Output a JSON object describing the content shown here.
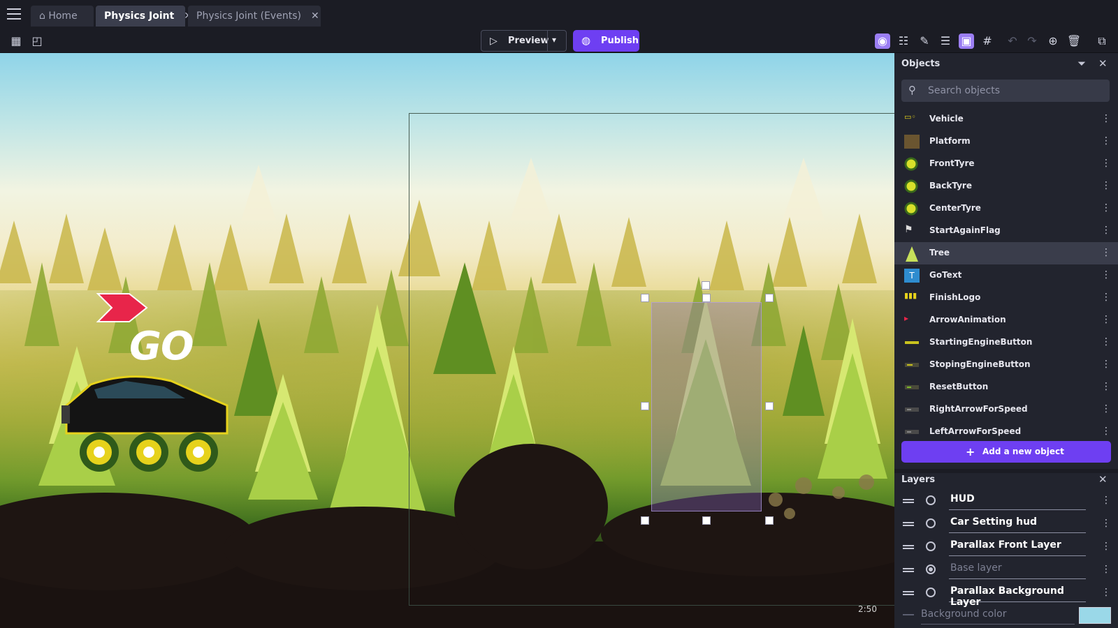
{
  "tabs": [
    {
      "label": "Home",
      "icon": "home-icon",
      "closable": false
    },
    {
      "label": "Physics Joint",
      "closable": true,
      "active": true
    },
    {
      "label": "Physics Joint (Events)",
      "closable": true
    }
  ],
  "toolbar": {
    "preview_label": "Preview",
    "publish_label": "Publish"
  },
  "scene": {
    "go_text": "GO",
    "zoom_label": "2:50"
  },
  "objects_panel": {
    "title": "Objects",
    "search_placeholder": "Search objects",
    "items": [
      {
        "name": "Vehicle",
        "icon": "vehicle-icon"
      },
      {
        "name": "Platform",
        "icon": "platform-icon"
      },
      {
        "name": "FrontTyre",
        "icon": "tyre-icon"
      },
      {
        "name": "BackTyre",
        "icon": "tyre-icon"
      },
      {
        "name": "CenterTyre",
        "icon": "tyre-icon"
      },
      {
        "name": "StartAgainFlag",
        "icon": "flag-icon"
      },
      {
        "name": "Tree",
        "icon": "tree-icon",
        "selected": true
      },
      {
        "name": "GoText",
        "icon": "text-object-icon"
      },
      {
        "name": "FinishLogo",
        "icon": "finish-logo-icon"
      },
      {
        "name": "ArrowAnimation",
        "icon": "arrow-animation-icon"
      },
      {
        "name": "StartingEngineButton",
        "icon": "button-icon"
      },
      {
        "name": "StopingEngineButton",
        "icon": "button-icon"
      },
      {
        "name": "ResetButton",
        "icon": "button-icon"
      },
      {
        "name": "RightArrowForSpeed",
        "icon": "button-icon"
      },
      {
        "name": "LeftArrowForSpeed",
        "icon": "button-icon"
      }
    ],
    "add_button_label": "Add a new object"
  },
  "layers_panel": {
    "title": "Layers",
    "layers": [
      {
        "name": "HUD",
        "base": false
      },
      {
        "name": "Car Setting hud",
        "base": false
      },
      {
        "name": "Parallax Front Layer",
        "base": false
      },
      {
        "name": "Base layer",
        "base": true
      },
      {
        "name": "Parallax Background Layer",
        "base": false
      }
    ],
    "background_color_label": "Background color",
    "background_color": "#9ad8e8"
  },
  "colors": {
    "accent": "#6e3ff2",
    "selected_tool": "#9b7ef3",
    "panel_bg": "#22242e"
  }
}
